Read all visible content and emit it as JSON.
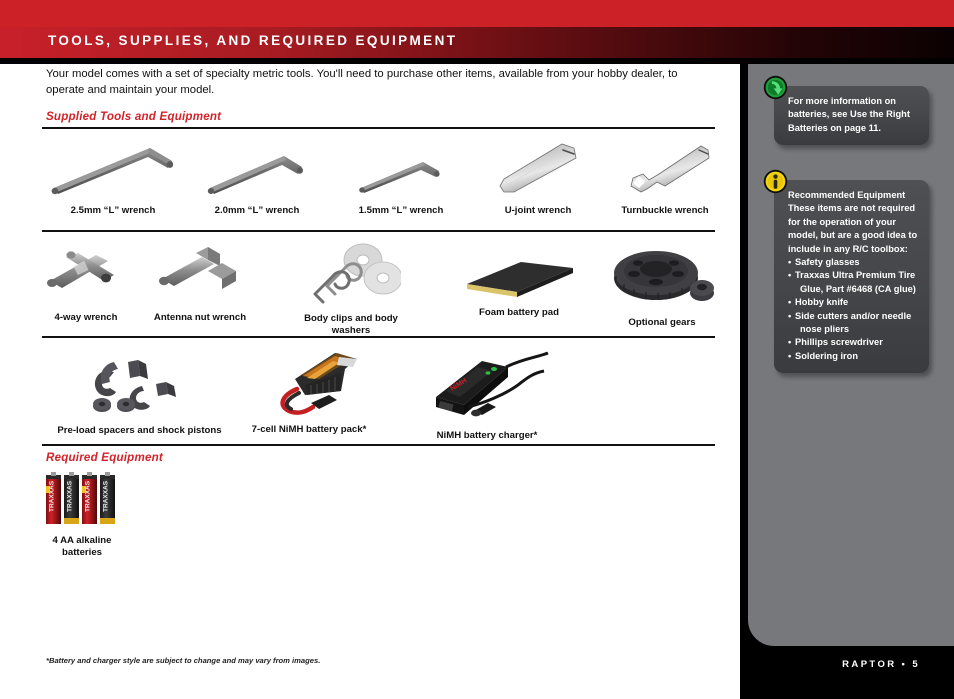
{
  "header": {
    "title": "TOOLS, SUPPLIES, AND REQUIRED EQUIPMENT"
  },
  "intro": "Your model comes with a set of specialty metric tools. You'll need to purchase other items, available from your hobby dealer, to operate and maintain your model.",
  "sections": {
    "supplied": "Supplied Tools and Equipment",
    "required": "Required Equipment"
  },
  "items": {
    "row1": [
      {
        "caption": "2.5mm “L”  wrench",
        "art": "l-wrench-large"
      },
      {
        "caption": "2.0mm “L”  wrench",
        "art": "l-wrench-medium"
      },
      {
        "caption": "1.5mm “L”  wrench",
        "art": "l-wrench-small"
      },
      {
        "caption": "U-joint wrench",
        "art": "u-joint-wrench"
      },
      {
        "caption": "Turnbuckle wrench",
        "art": "turnbuckle-wrench"
      }
    ],
    "row2": [
      {
        "caption": "4-way wrench",
        "art": "four-way-wrench"
      },
      {
        "caption": "Antenna nut wrench",
        "art": "antenna-nut-wrench"
      },
      {
        "caption": "Body clips and body washers",
        "art": "body-clips-washers"
      },
      {
        "caption": "Foam battery pad",
        "art": "foam-battery-pad"
      },
      {
        "caption": "Optional gears",
        "art": "optional-gears"
      }
    ],
    "row3": [
      {
        "caption": "Pre-load spacers and shock pistons",
        "art": "preload-spacers-pistons"
      },
      {
        "caption": "7-cell NiMH battery pack*",
        "art": "nimh-battery-pack"
      },
      {
        "caption": "NiMH battery charger*",
        "art": "nimh-battery-charger"
      }
    ],
    "row4": [
      {
        "caption": "4 AA alkaline\nbatteries",
        "art": "aa-batteries"
      }
    ]
  },
  "sidebar": {
    "notes": [
      {
        "icon": "green-arrow-icon",
        "text": "For more information on batteries, see Use the Right Batteries on page 11."
      },
      {
        "icon": "yellow-info-icon",
        "title": "Recommended Equipment",
        "text": "These items are not required for the operation of your model, but are a good idea to include in any R/C toolbox:",
        "list": [
          "Safety glasses",
          "Traxxas Ultra Premium Tire",
          "Glue, Part #6468 (CA glue)",
          "Hobby knife",
          "Side cutters and/or needle",
          "nose pliers",
          "Phillips screwdriver",
          "Soldering iron"
        ],
        "list_continuation_indices": [
          2,
          5
        ]
      }
    ]
  },
  "footnote": "*Battery and charger style are subject to change and may vary from images.",
  "footer": {
    "page_label": "RAPTOR  •  5"
  },
  "colors": {
    "brand_red": "#cd2128",
    "header_dark": "#0b0102",
    "sidebar_gray": "#77787c",
    "note_gray": "#45464a",
    "caption_black": "#111111"
  }
}
